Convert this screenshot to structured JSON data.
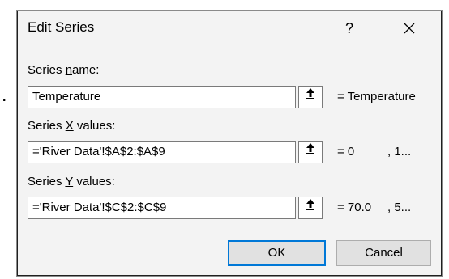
{
  "window": {
    "title": "Edit Series",
    "help_label": "?",
    "background_fragment": "."
  },
  "series_name": {
    "label_prefix": "Series ",
    "label_accel": "n",
    "label_suffix": "ame:",
    "value": "Temperature",
    "preview": "= Temperature"
  },
  "series_x": {
    "label_prefix": "Series ",
    "label_accel": "X",
    "label_suffix": " values:",
    "value": "='River Data'!$A$2:$A$9",
    "preview_first": "= 0",
    "preview_more": ", 1..."
  },
  "series_y": {
    "label_prefix": "Series ",
    "label_accel": "Y",
    "label_suffix": " values:",
    "value": "='River Data'!$C$2:$C$9",
    "preview_first": "= 70.0",
    "preview_more": ", 5..."
  },
  "buttons": {
    "ok": "OK",
    "cancel": "Cancel"
  },
  "colors": {
    "dialog_bg": "#f3f3f3",
    "ok_focus_border": "#0078d7"
  },
  "icons": {
    "collapse": "collapse-dialog-icon",
    "close": "close-icon"
  }
}
